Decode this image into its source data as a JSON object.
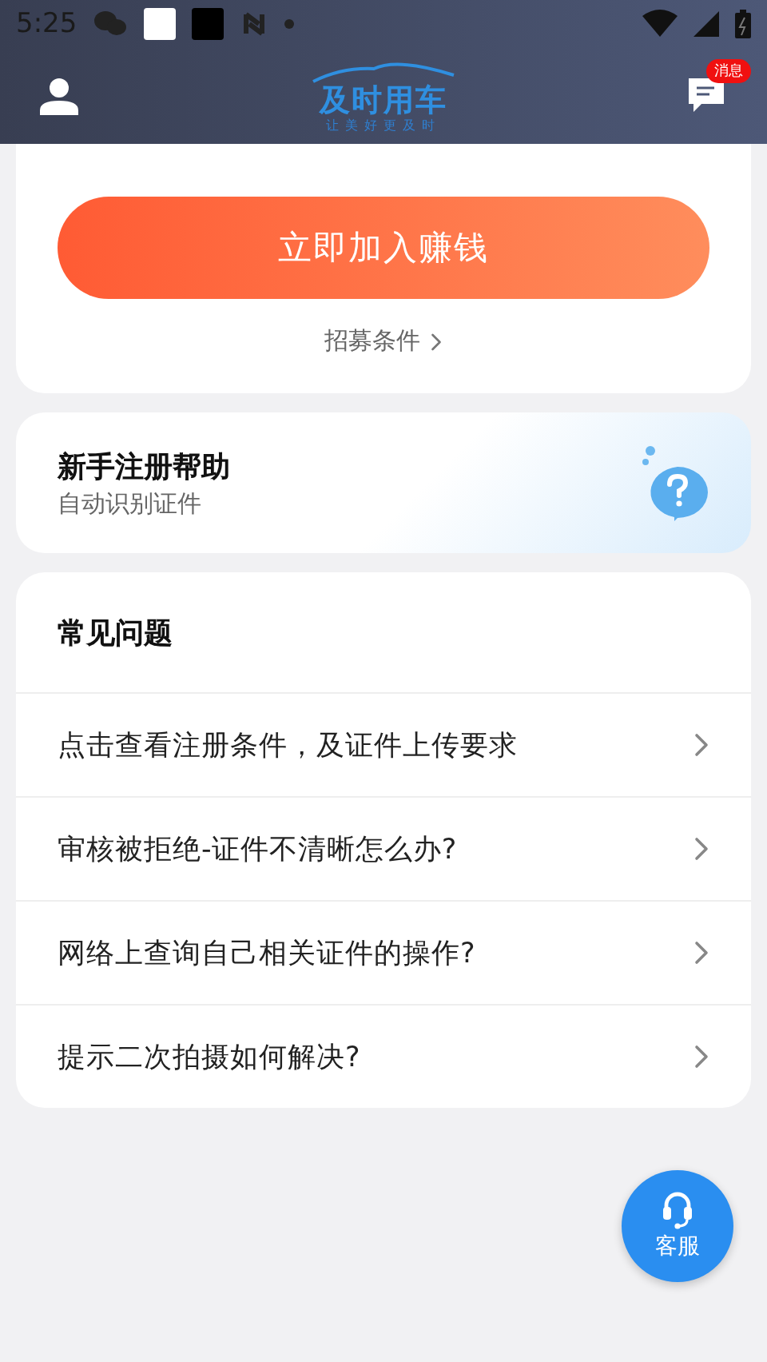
{
  "status_bar": {
    "time": "5:25"
  },
  "header": {
    "logo_title": "及时用车",
    "logo_slogan": "让美好更及时",
    "badge": "消息"
  },
  "join_card": {
    "button": "立即加入赚钱",
    "link": "招募条件"
  },
  "help_card": {
    "title": "新手注册帮助",
    "subtitle": "自动识别证件"
  },
  "faq": {
    "title": "常见问题",
    "items": [
      {
        "text": "点击查看注册条件，及证件上传要求"
      },
      {
        "text": "审核被拒绝-证件不清晰怎么办?"
      },
      {
        "text": "网络上查询自己相关证件的操作?"
      },
      {
        "text": "提示二次拍摄如何解决?"
      }
    ]
  },
  "service_button": {
    "label": "客服"
  }
}
